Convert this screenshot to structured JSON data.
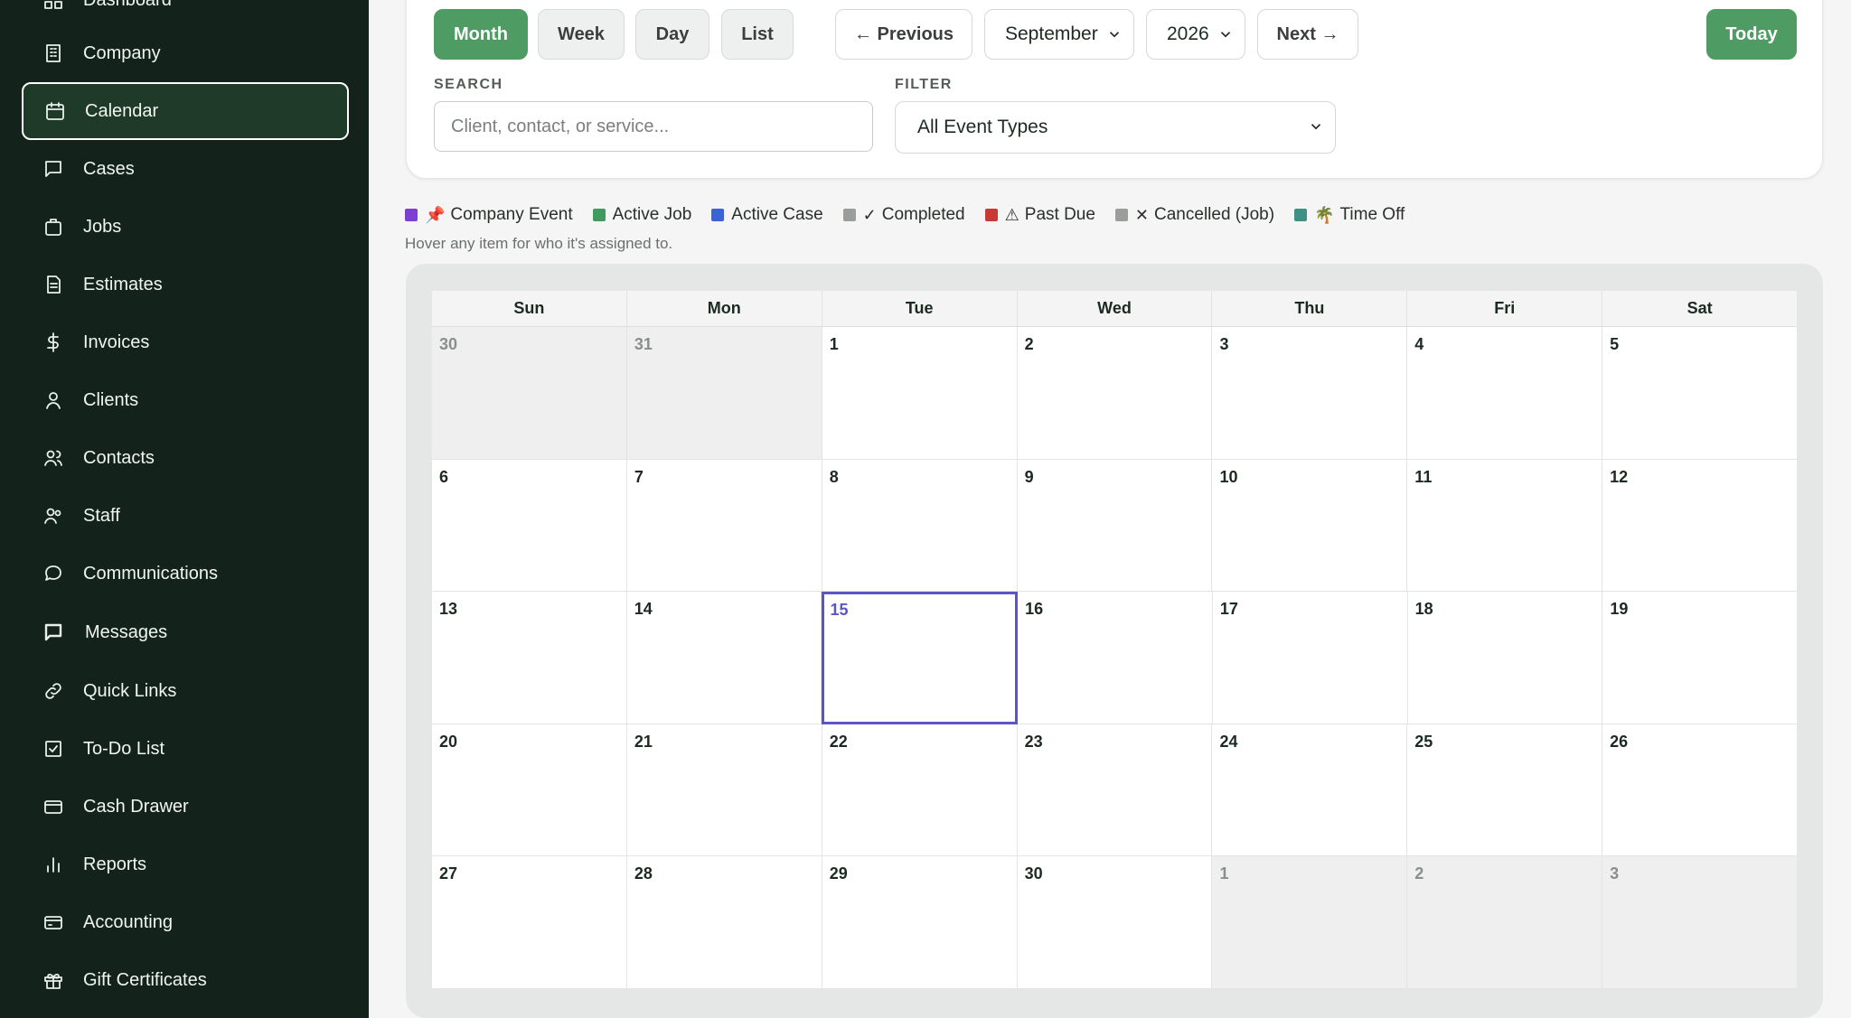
{
  "sidebar": {
    "items": [
      {
        "label": "Dashboard",
        "icon": "dashboard-icon"
      },
      {
        "label": "Company",
        "icon": "building-icon"
      },
      {
        "label": "Calendar",
        "icon": "calendar-icon",
        "active": true
      },
      {
        "label": "Cases",
        "icon": "chat-bubble-icon"
      },
      {
        "label": "Jobs",
        "icon": "briefcase-icon"
      },
      {
        "label": "Estimates",
        "icon": "document-icon"
      },
      {
        "label": "Invoices",
        "icon": "dollar-icon"
      },
      {
        "label": "Clients",
        "icon": "user-icon"
      },
      {
        "label": "Contacts",
        "icon": "users-icon"
      },
      {
        "label": "Staff",
        "icon": "staff-icon"
      },
      {
        "label": "Communications",
        "icon": "speech-bubble-icon"
      },
      {
        "label": "Messages",
        "icon": "message-icon"
      },
      {
        "label": "Quick Links",
        "icon": "link-icon"
      },
      {
        "label": "To-Do List",
        "icon": "checkbox-icon"
      },
      {
        "label": "Cash Drawer",
        "icon": "cash-drawer-icon"
      },
      {
        "label": "Reports",
        "icon": "bar-chart-icon"
      },
      {
        "label": "Accounting",
        "icon": "card-icon"
      },
      {
        "label": "Gift Certificates",
        "icon": "gift-icon"
      }
    ]
  },
  "toolbar": {
    "views": [
      "Month",
      "Week",
      "Day",
      "List"
    ],
    "active_view": "Month",
    "previous_label": "← Previous",
    "next_label": "Next →",
    "month_value": "September",
    "year_value": "2026",
    "today_label": "Today",
    "search_label": "SEARCH",
    "search_placeholder": "Client, contact, or service...",
    "filter_label": "FILTER",
    "filter_value": "All Event Types"
  },
  "legend": {
    "items": [
      {
        "label": "Company Event",
        "color": "#7b3fd1",
        "glyph": "📌"
      },
      {
        "label": "Active Job",
        "color": "#3f9a5d",
        "glyph": ""
      },
      {
        "label": "Active Case",
        "color": "#3a63d8",
        "glyph": ""
      },
      {
        "label": "Completed",
        "color": "#9a9e9b",
        "glyph": "✓"
      },
      {
        "label": "Past Due",
        "color": "#c93a35",
        "glyph": "⚠"
      },
      {
        "label": "Cancelled (Job)",
        "color": "#9a9e9b",
        "glyph": "✕"
      },
      {
        "label": "Time Off",
        "color": "#3f8f84",
        "glyph": "🌴"
      }
    ],
    "hint": "Hover any item for who it's assigned to."
  },
  "calendar": {
    "weekdays": [
      "Sun",
      "Mon",
      "Tue",
      "Wed",
      "Thu",
      "Fri",
      "Sat"
    ],
    "today": "15",
    "weeks": [
      [
        {
          "d": "30",
          "other": true
        },
        {
          "d": "31",
          "other": true
        },
        {
          "d": "1"
        },
        {
          "d": "2"
        },
        {
          "d": "3"
        },
        {
          "d": "4"
        },
        {
          "d": "5"
        }
      ],
      [
        {
          "d": "6"
        },
        {
          "d": "7"
        },
        {
          "d": "8"
        },
        {
          "d": "9"
        },
        {
          "d": "10"
        },
        {
          "d": "11"
        },
        {
          "d": "12"
        }
      ],
      [
        {
          "d": "13"
        },
        {
          "d": "14"
        },
        {
          "d": "15",
          "today": true
        },
        {
          "d": "16"
        },
        {
          "d": "17"
        },
        {
          "d": "18"
        },
        {
          "d": "19"
        }
      ],
      [
        {
          "d": "20"
        },
        {
          "d": "21"
        },
        {
          "d": "22"
        },
        {
          "d": "23"
        },
        {
          "d": "24"
        },
        {
          "d": "25"
        },
        {
          "d": "26"
        }
      ],
      [
        {
          "d": "27"
        },
        {
          "d": "28"
        },
        {
          "d": "29"
        },
        {
          "d": "30"
        },
        {
          "d": "1",
          "other": true
        },
        {
          "d": "2",
          "other": true
        },
        {
          "d": "3",
          "other": true
        }
      ]
    ]
  }
}
